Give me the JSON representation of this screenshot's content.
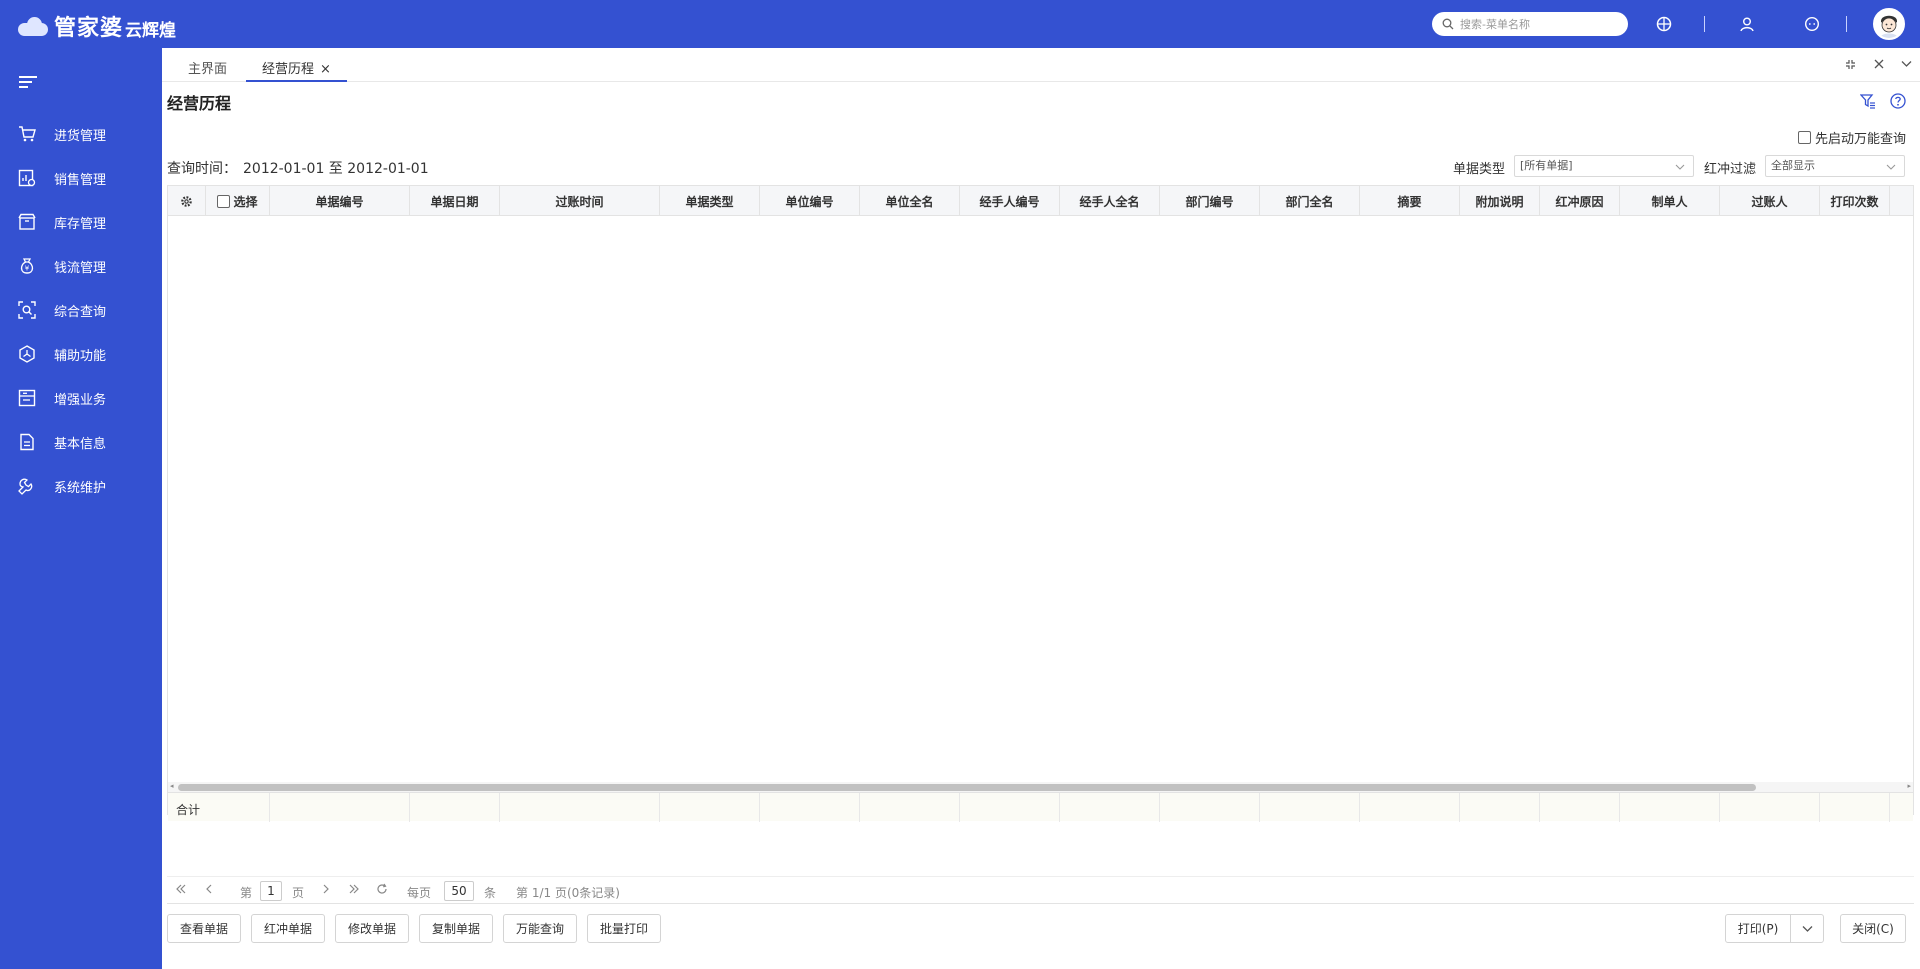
{
  "app": {
    "brand": "管家婆",
    "product": "云辉煌"
  },
  "search": {
    "placeholder": "搜索-菜单名称"
  },
  "sidebar": {
    "items": [
      {
        "label": "进货管理",
        "icon": "cart-icon"
      },
      {
        "label": "销售管理",
        "icon": "sales-chart-icon"
      },
      {
        "label": "库存管理",
        "icon": "box-icon"
      },
      {
        "label": "钱流管理",
        "icon": "money-bag-icon"
      },
      {
        "label": "综合查询",
        "icon": "query-scan-icon"
      },
      {
        "label": "辅助功能",
        "icon": "hexagon-icon"
      },
      {
        "label": "增强业务",
        "icon": "board-icon"
      },
      {
        "label": "基本信息",
        "icon": "document-icon"
      },
      {
        "label": "系统维护",
        "icon": "wrench-icon"
      }
    ]
  },
  "tabs": [
    {
      "label": "主界面"
    },
    {
      "label": "经营历程",
      "close": "×"
    }
  ],
  "page": {
    "title": "经营历程",
    "wan_checkbox_label": "先启动万能查询",
    "query_time_label": "查询时间：",
    "query_time_value": "2012-01-01 至 2012-01-01",
    "bill_type_label": "单据类型",
    "bill_type_value": "[所有单据]",
    "red_filter_label": "红冲过滤",
    "red_filter_value": "全部显示"
  },
  "table": {
    "select_label": "选择",
    "columns": [
      "单据编号",
      "单据日期",
      "过账时间",
      "单据类型",
      "单位编号",
      "单位全名",
      "经手人编号",
      "经手人全名",
      "部门编号",
      "部门全名",
      "摘要",
      "附加说明",
      "红冲原因",
      "制单人",
      "过账人",
      "打印次数"
    ],
    "sum_label": "合计"
  },
  "pager": {
    "page_prefix": "第",
    "page_value": "1",
    "page_suffix": "页",
    "per_page_label": "每页",
    "per_page_value": "50",
    "per_page_unit": "条",
    "summary": "第 1/1 页(0条记录)"
  },
  "buttons": {
    "view": "查看单据",
    "red": "红冲单据",
    "modify": "修改单据",
    "copy": "复制单据",
    "wan": "万能查询",
    "batch_print": "批量打印",
    "print": "打印(P)",
    "close": "关闭(C)"
  }
}
